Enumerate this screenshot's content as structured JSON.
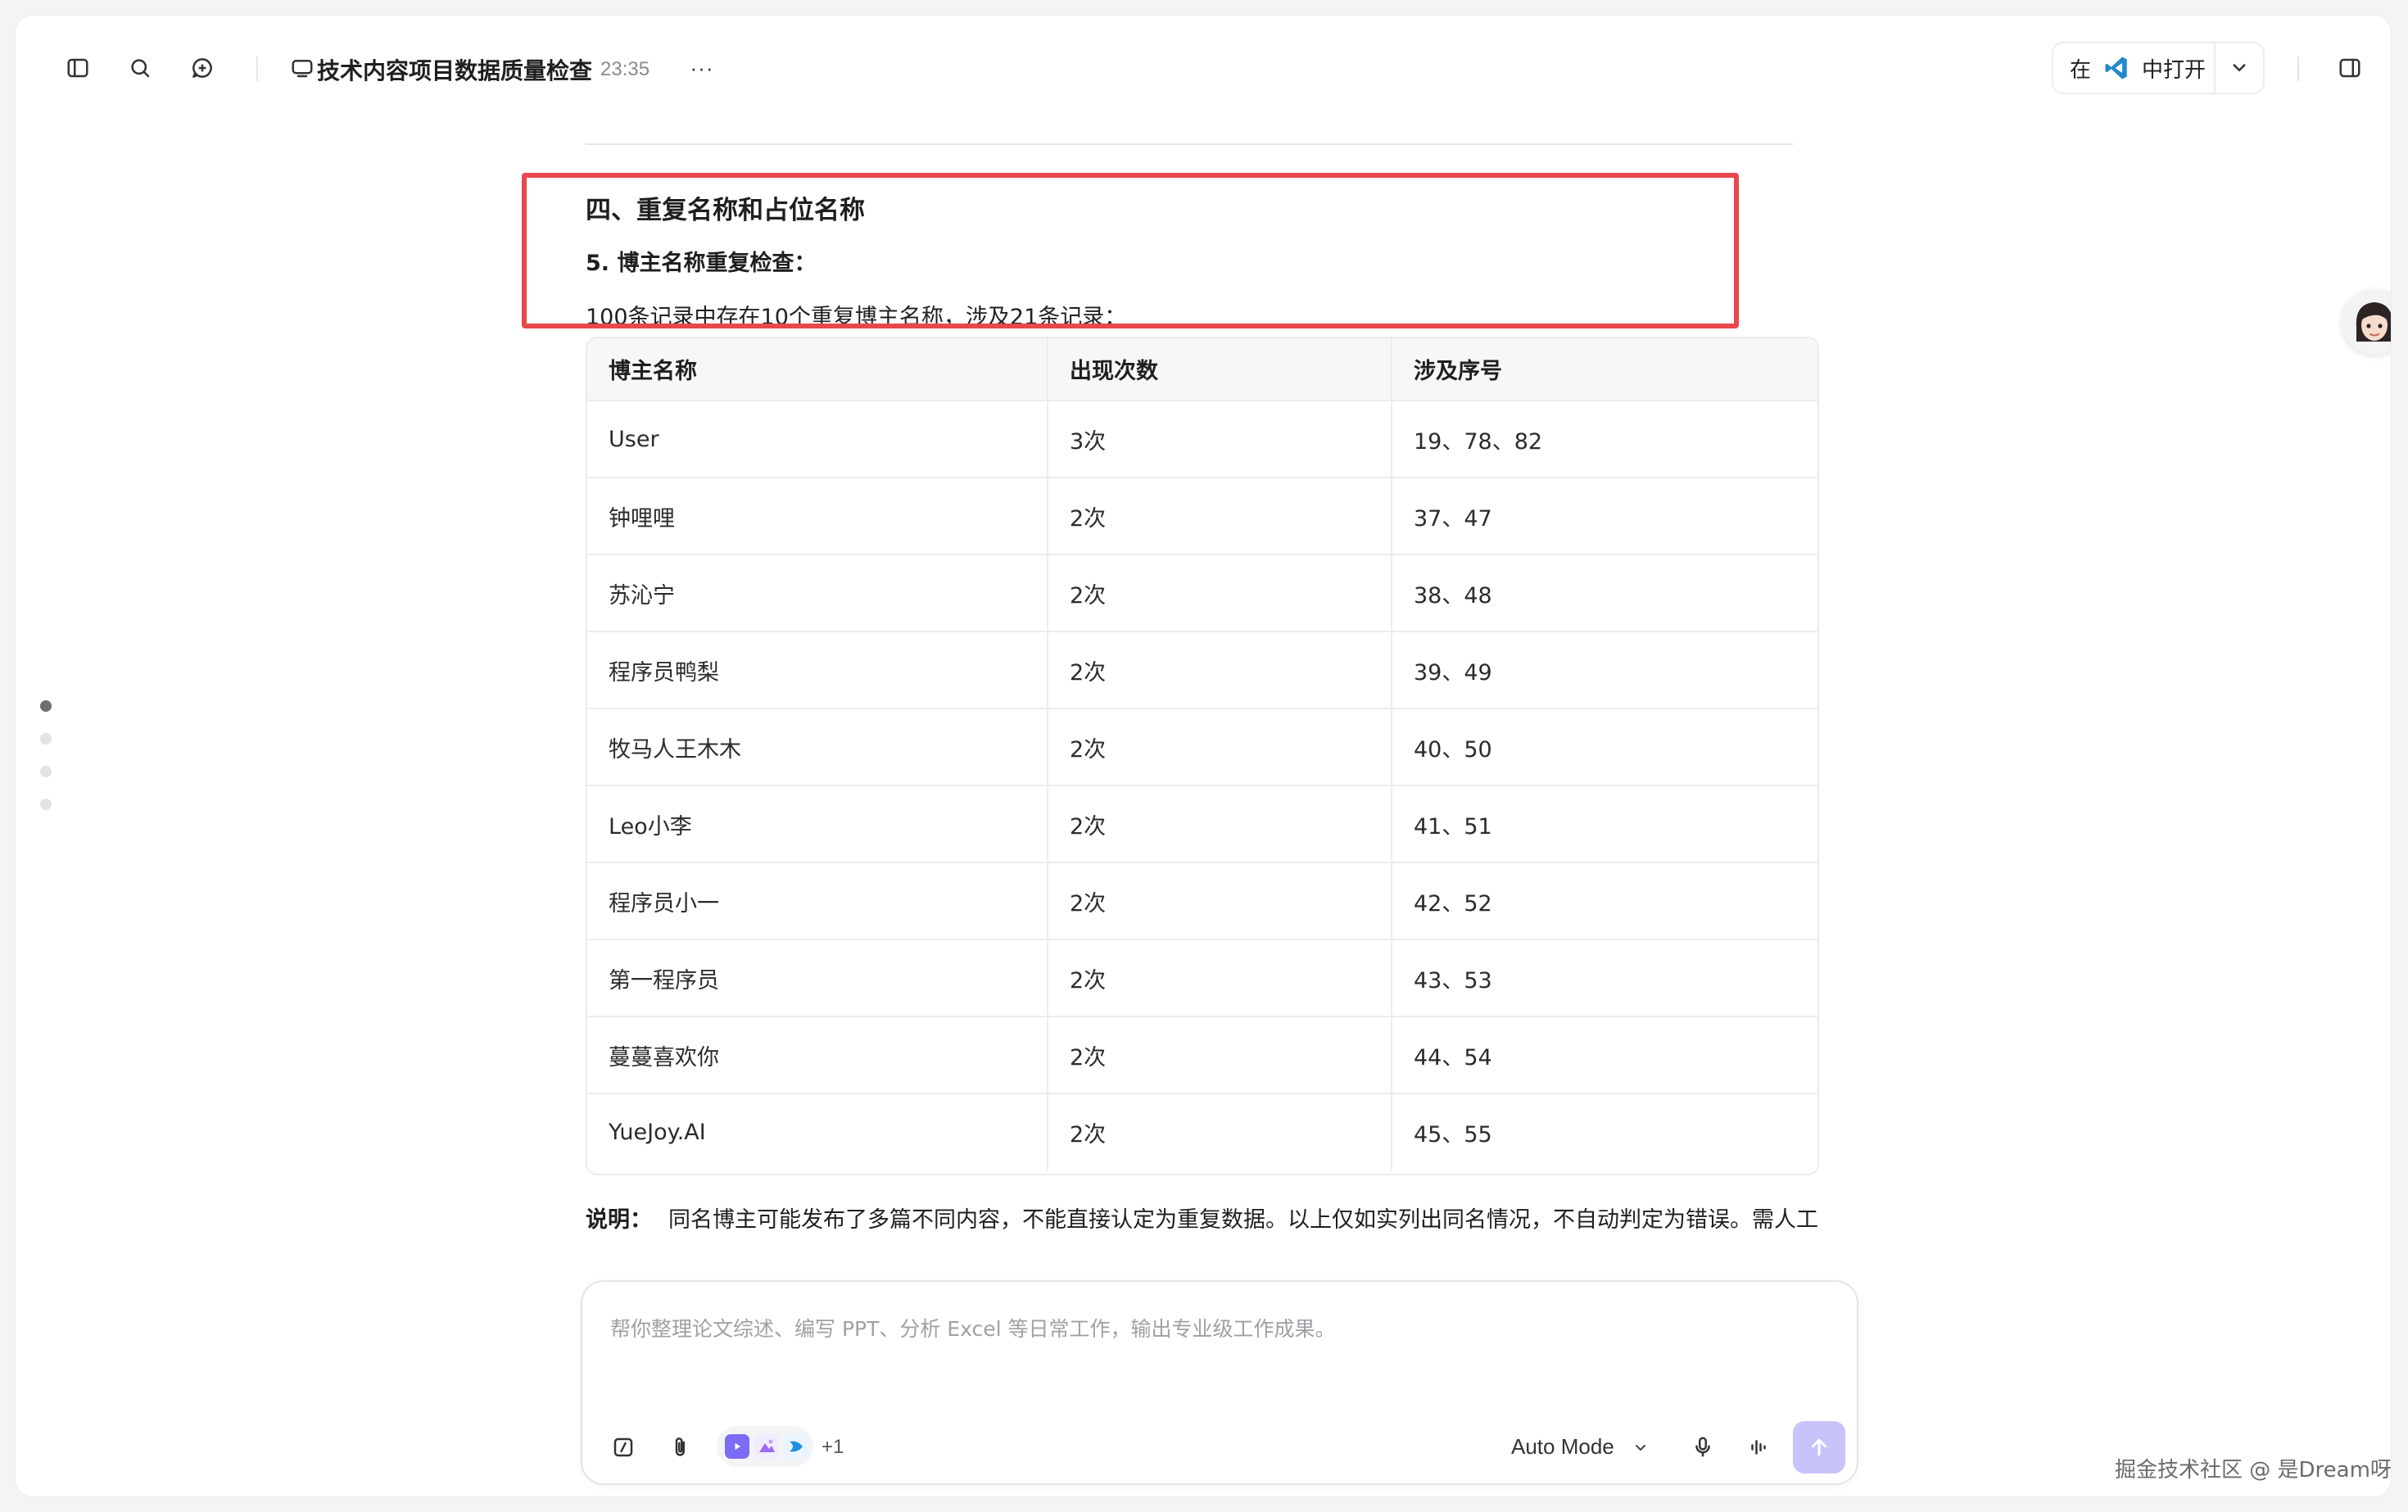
{
  "header": {
    "title": "技术内容项目数据质量检查",
    "time": "23:35",
    "more_label": "···",
    "open_in": {
      "prefix": "在",
      "suffix": "中打开"
    }
  },
  "content": {
    "section_heading": "四、重复名称和占位名称",
    "sub_heading": "5. 博主名称重复检查：",
    "summary": "100条记录中存在10个重复博主名称，涉及21条记录：",
    "table": {
      "headers": [
        "博主名称",
        "出现次数",
        "涉及序号"
      ],
      "rows": [
        [
          "User",
          "3次",
          "19、78、82"
        ],
        [
          "钟哩哩",
          "2次",
          "37、47"
        ],
        [
          "苏沁宁",
          "2次",
          "38、48"
        ],
        [
          "程序员鸭梨",
          "2次",
          "39、49"
        ],
        [
          "牧马人王木木",
          "2次",
          "40、50"
        ],
        [
          "Leo小李",
          "2次",
          "41、51"
        ],
        [
          "程序员小一",
          "2次",
          "42、52"
        ],
        [
          "第一程序员",
          "2次",
          "43、53"
        ],
        [
          "蔓蔓喜欢你",
          "2次",
          "44、54"
        ],
        [
          "YueJoy.AI",
          "2次",
          "45、55"
        ]
      ]
    },
    "note_label": "说明：",
    "note_text": "同名博主可能发布了多篇不同内容，不能直接认定为重复数据。以上仅如实列出同名情况，不自动判定为错误。需人工确认这些同名记录是同一博主的多次发布，还是不同博主使用了相同昵称。"
  },
  "composer": {
    "placeholder": "帮你整理论文综述、编写 PPT、分析 Excel 等日常工作，输出专业级工作成果。",
    "more_tools": "+1",
    "mode": "Auto Mode"
  },
  "watermark": "掘金技术社区 @ 是Dream呀",
  "colors": {
    "highlight_border": "#e8474b",
    "send_button": "#c7c3fb",
    "vscode_blue": "#2489ca"
  }
}
